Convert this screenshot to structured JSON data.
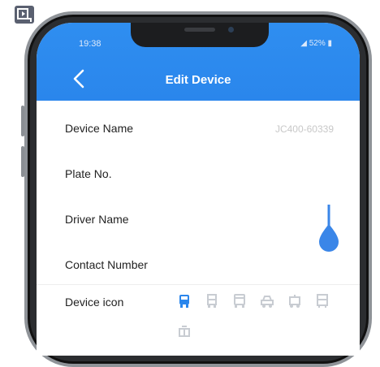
{
  "status_bar": {
    "time": "19:38",
    "battery": "52%"
  },
  "header": {
    "title": "Edit Device"
  },
  "form": {
    "rows": [
      {
        "label": "Device Name",
        "value": "JC400-60339"
      },
      {
        "label": "Plate No.",
        "value": ""
      },
      {
        "label": "Driver Name",
        "value": ""
      },
      {
        "label": "Contact Number",
        "value": ""
      },
      {
        "label": "Device icon",
        "value": ""
      }
    ]
  },
  "device_icons": [
    "bus-icon",
    "truck-icon",
    "bus-front-icon",
    "car-icon",
    "tanker-icon",
    "coach-icon",
    "building-icon"
  ],
  "colors": {
    "header": "#2a86ec",
    "selected_icon": "#2a86ec",
    "unselected_icon": "#c8ccd2",
    "slider": "#3a86e8"
  }
}
